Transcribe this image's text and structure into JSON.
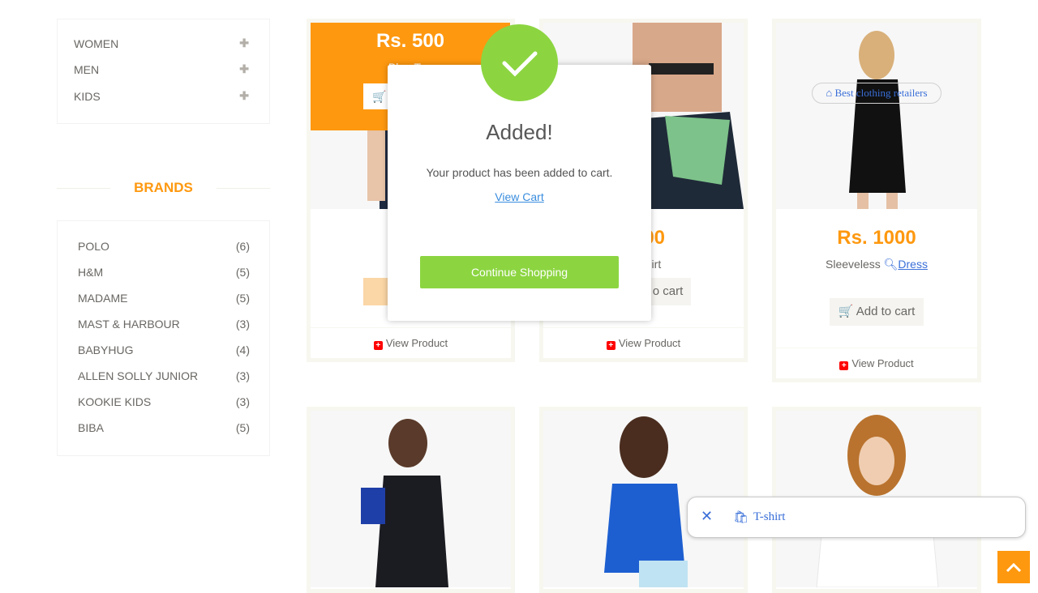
{
  "categories": [
    {
      "label": "WOMEN"
    },
    {
      "label": "MEN"
    },
    {
      "label": "KIDS"
    }
  ],
  "brands_title": "BRANDS",
  "brands": [
    {
      "name": "POLO",
      "count": "(6)"
    },
    {
      "name": "H&M",
      "count": "(5)"
    },
    {
      "name": "MADAME",
      "count": "(5)"
    },
    {
      "name": "MAST & HARBOUR",
      "count": "(3)"
    },
    {
      "name": "BABYHUG",
      "count": "(4)"
    },
    {
      "name": "ALLEN SOLLY JUNIOR",
      "count": "(3)"
    },
    {
      "name": "KOOKIE KIDS",
      "count": "(3)"
    },
    {
      "name": "BIBA",
      "count": "(5)"
    }
  ],
  "products": [
    {
      "overlay_price": "Rs. 500",
      "overlay_name": "Blue Top",
      "price": "R",
      "view": "View Product"
    },
    {
      "price": "400",
      "name": "shirt",
      "cart": "o cart",
      "view": "View Product"
    },
    {
      "price": "Rs. 1000",
      "name": "Sleeveless",
      "tag_word": "Dress",
      "tag_pill": "Best clothing retailers",
      "cart": "Add to cart",
      "view": "View Product"
    }
  ],
  "modal": {
    "title": "Added!",
    "text": "Your product has been added to cart.",
    "link": "View Cart",
    "button": "Continue Shopping"
  },
  "search_pill": {
    "text": "T-shirt"
  },
  "colors": {
    "accent": "#fe980f",
    "success": "#8cd541",
    "link": "#3a8dde"
  }
}
